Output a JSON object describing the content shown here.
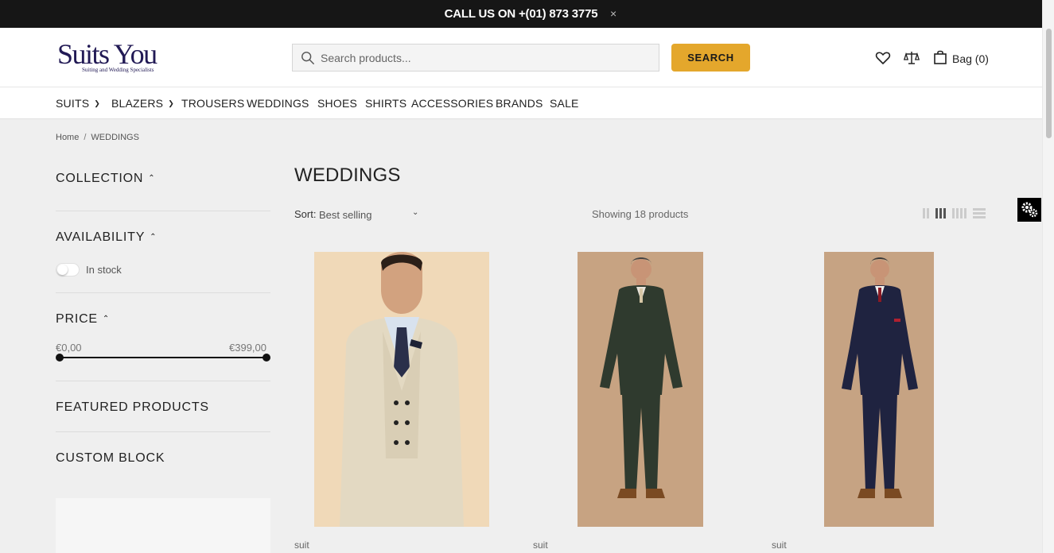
{
  "announcement": {
    "text": "CALL US ON +(01) 873 3775",
    "close": "×"
  },
  "logo": {
    "name": "Suits You",
    "tagline": "Suiting and Wedding Specialists"
  },
  "search": {
    "placeholder": "Search products...",
    "button": "SEARCH"
  },
  "header_icons": [
    "heart-icon",
    "compare-scale-icon",
    "bag-icon"
  ],
  "bag": {
    "label": "Bag (0)"
  },
  "nav": {
    "items": [
      {
        "label": "SUITS",
        "dropdown": true
      },
      {
        "label": "BLAZERS",
        "dropdown": true
      },
      {
        "label": "TROUSERS",
        "dropdown": false
      },
      {
        "label": "WEDDINGS",
        "dropdown": false
      },
      {
        "label": "SHOES",
        "dropdown": false
      },
      {
        "label": "SHIRTS",
        "dropdown": false
      },
      {
        "label": "ACCESSORIES",
        "dropdown": false
      },
      {
        "label": "BRANDS",
        "dropdown": false
      },
      {
        "label": "SALE",
        "dropdown": false
      }
    ]
  },
  "breadcrumb": {
    "home": "Home",
    "separator": "/",
    "current": "WEDDINGS"
  },
  "filters": {
    "collection": "COLLECTION",
    "availability": "AVAILABILITY",
    "in_stock": "In stock",
    "in_stock_enabled": false,
    "price": "PRICE",
    "price_min": "€0,00",
    "price_max": "€399,00",
    "featured": "FEATURED PRODUCTS",
    "custom_block": "CUSTOM BLOCK"
  },
  "page": {
    "title": "WEDDINGS",
    "sort_label": "Sort:",
    "sort_value": "Best selling",
    "showing": "Showing 18 products",
    "active_grid": "3-columns"
  },
  "products": [
    {
      "type": "suit",
      "suit_color": "#e3d9c2",
      "background": "#efd7b5"
    },
    {
      "type": "suit",
      "suit_color": "#2f3a2e",
      "background": "#c7a382"
    },
    {
      "type": "suit",
      "suit_color": "#1f2340",
      "background": "#c6a383"
    }
  ],
  "colors": {
    "accent": "#e4a72c",
    "topbar": "#161616",
    "logo": "#221a55"
  }
}
